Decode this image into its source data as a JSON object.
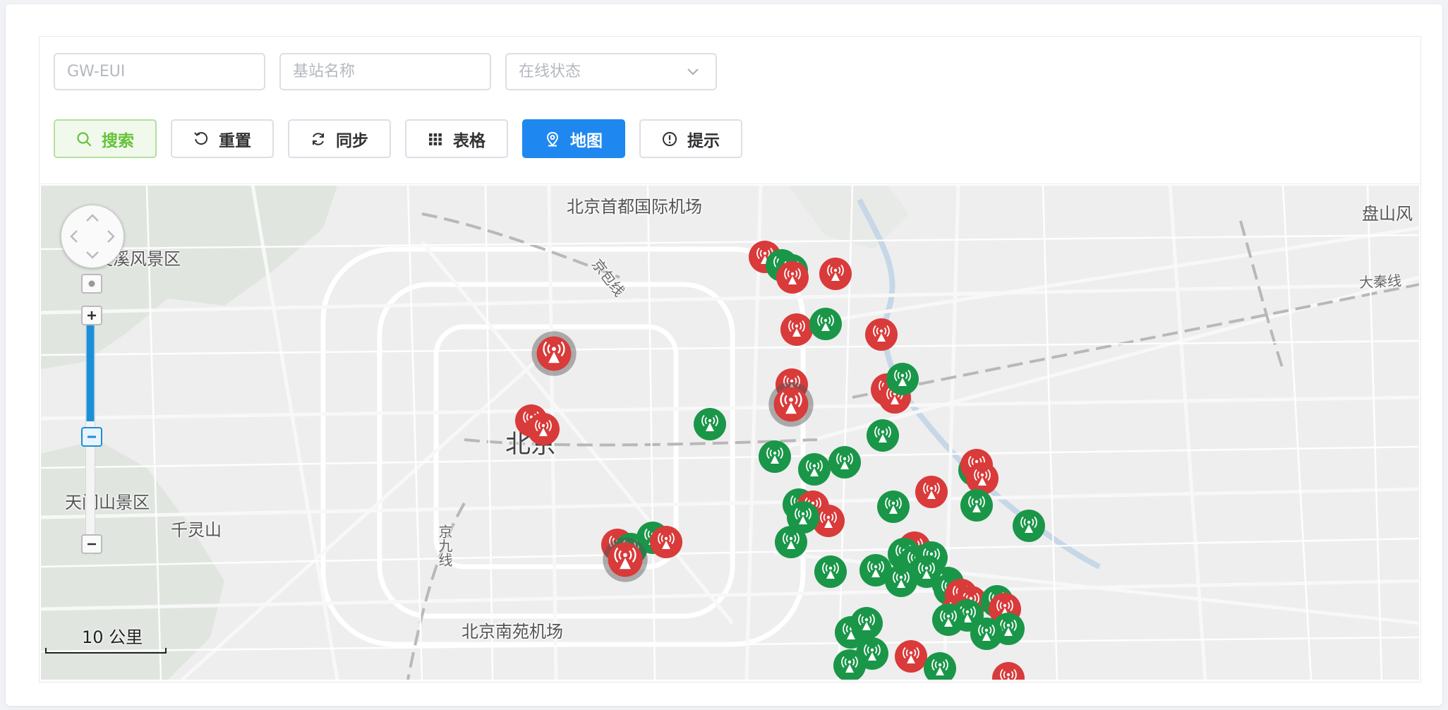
{
  "filters": {
    "gw_eui_placeholder": "GW-EUI",
    "name_placeholder": "基站名称",
    "status_placeholder": "在线状态"
  },
  "toolbar": {
    "search": "搜索",
    "reset": "重置",
    "sync": "同步",
    "table": "表格",
    "map": "地图",
    "tips": "提示"
  },
  "map": {
    "labels": {
      "airport_capital": "北京首都国际机场",
      "panshan": "盘山风",
      "lingxi": "灵溪风景区",
      "jingbao": "京包线",
      "daqin": "大秦线",
      "beijing": "北京",
      "tianmen": "天门山景区",
      "qianling": "千灵山",
      "jingjiu": "京九线",
      "nanyuan": "北京南苑机场"
    },
    "scale_label": "10 公里",
    "colors": {
      "online": "#1a9648",
      "offline": "#d93a3a"
    }
  }
}
